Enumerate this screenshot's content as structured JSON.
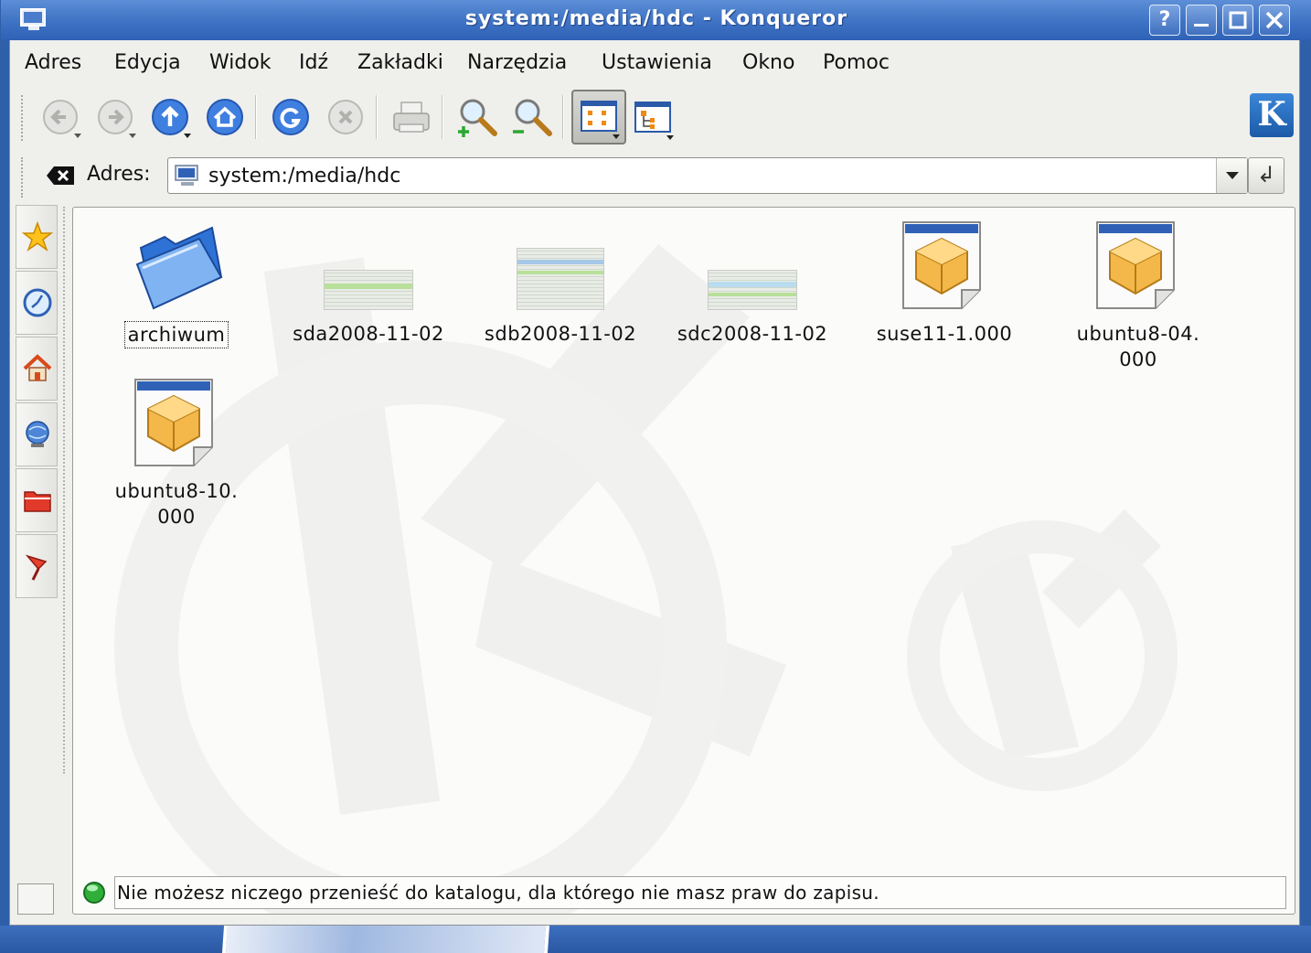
{
  "window": {
    "title": "system:/media/hdc - Konqueror",
    "buttons": {
      "help": "?",
      "minimize": "_",
      "maximize": "□",
      "close": "✕"
    }
  },
  "menubar": {
    "items": [
      "Adres",
      "Edycja",
      "Widok",
      "Idź",
      "Zakładki",
      "Narzędzia",
      "Ustawienia",
      "Okno",
      "Pomoc"
    ]
  },
  "toolbar": {
    "icons": [
      "back-icon",
      "forward-icon",
      "up-icon",
      "home-icon",
      "reload-icon",
      "stop-icon",
      "print-icon",
      "zoom-in-icon",
      "zoom-out-icon",
      "icon-view-icon",
      "tree-view-icon"
    ],
    "logo": "K"
  },
  "location": {
    "label": "Adres:",
    "value": "system:/media/hdc",
    "go": "↲"
  },
  "sidebar": {
    "icons": [
      "bookmarks-icon",
      "history-icon",
      "home-folder-icon",
      "network-icon",
      "root-folder-icon",
      "services-icon"
    ]
  },
  "files": [
    {
      "name": "archiwum",
      "type": "folder",
      "selected": true
    },
    {
      "name": "sda2008-11-02",
      "type": "thumbnail"
    },
    {
      "name": "sdb2008-11-02",
      "type": "thumbnail"
    },
    {
      "name": "sdc2008-11-02",
      "type": "thumbnail"
    },
    {
      "name": "suse11-1.000",
      "type": "package"
    },
    {
      "name_line1": "ubuntu8-04.",
      "name_line2": "000",
      "type": "package"
    },
    {
      "name_line1": "ubuntu8-10.",
      "name_line2": "000",
      "type": "package"
    }
  ],
  "status": {
    "message": "Nie możesz niczego przenieść do katalogu, dla którego nie masz praw do zapisu."
  },
  "colors": {
    "titlebar": "#3e72c4",
    "accent": "#2f5fa8",
    "status_led": "#2fae3a"
  }
}
